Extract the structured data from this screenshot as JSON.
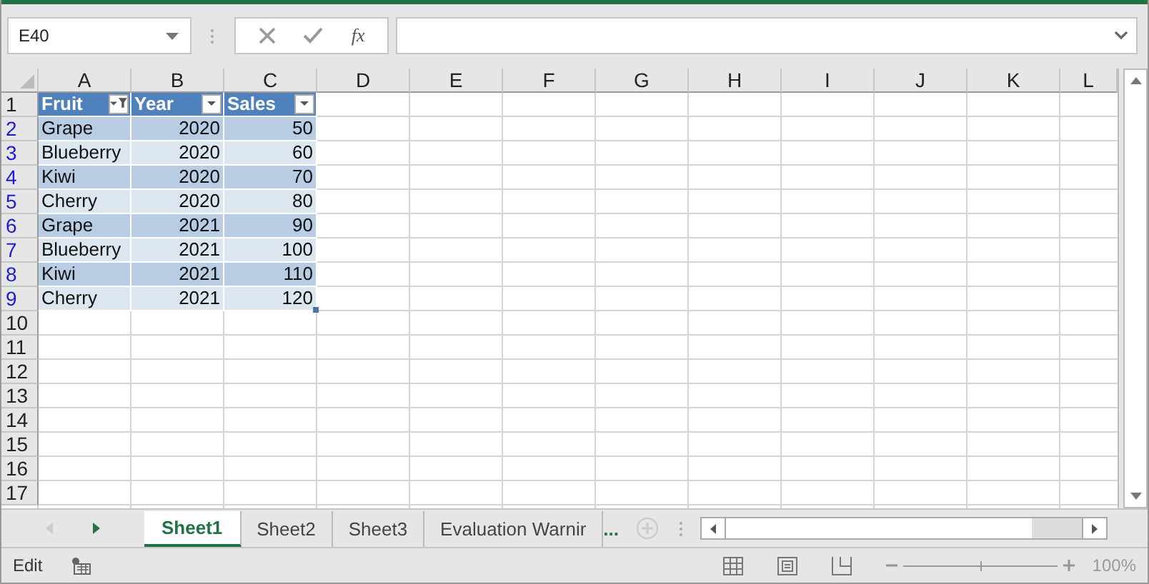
{
  "name_box": {
    "value": "E40"
  },
  "formula_bar": {
    "cancel_disabled": true,
    "enter_disabled": true,
    "function_label": "fx"
  },
  "column_headers": [
    "A",
    "B",
    "C",
    "D",
    "E",
    "F",
    "G",
    "H",
    "I",
    "J",
    "K",
    "L"
  ],
  "row_headers": [
    {
      "label": "1",
      "filtered": false
    },
    {
      "label": "2",
      "filtered": true
    },
    {
      "label": "3",
      "filtered": true
    },
    {
      "label": "4",
      "filtered": true
    },
    {
      "label": "5",
      "filtered": true
    },
    {
      "label": "6",
      "filtered": true
    },
    {
      "label": "7",
      "filtered": true
    },
    {
      "label": "8",
      "filtered": true
    },
    {
      "label": "9",
      "filtered": true
    },
    {
      "label": "10",
      "filtered": false
    },
    {
      "label": "11",
      "filtered": false
    },
    {
      "label": "12",
      "filtered": false
    },
    {
      "label": "13",
      "filtered": false
    },
    {
      "label": "14",
      "filtered": false
    },
    {
      "label": "15",
      "filtered": false
    },
    {
      "label": "16",
      "filtered": false
    },
    {
      "label": "17",
      "filtered": false
    }
  ],
  "table": {
    "columns": [
      {
        "label": "Fruit",
        "kind": "text",
        "filtered": true
      },
      {
        "label": "Year",
        "kind": "number",
        "filtered": false
      },
      {
        "label": "Sales",
        "kind": "number",
        "filtered": false
      }
    ],
    "rows": [
      [
        "Grape",
        "2020",
        "50"
      ],
      [
        "Blueberry",
        "2020",
        "60"
      ],
      [
        "Kiwi",
        "2020",
        "70"
      ],
      [
        "Cherry",
        "2020",
        "80"
      ],
      [
        "Grape",
        "2021",
        "90"
      ],
      [
        "Blueberry",
        "2021",
        "100"
      ],
      [
        "Kiwi",
        "2021",
        "110"
      ],
      [
        "Cherry",
        "2021",
        "120"
      ]
    ]
  },
  "sheet_tabs": [
    {
      "label": "Sheet1",
      "selected": true
    },
    {
      "label": "Sheet2",
      "selected": false
    },
    {
      "label": "Sheet3",
      "selected": false
    },
    {
      "label": "Evaluation Warnir",
      "selected": false
    }
  ],
  "more_sheets": "...",
  "status_bar": {
    "mode": "Edit",
    "zoom_slider": {
      "level": 0.5
    },
    "zoom": "100%"
  }
}
